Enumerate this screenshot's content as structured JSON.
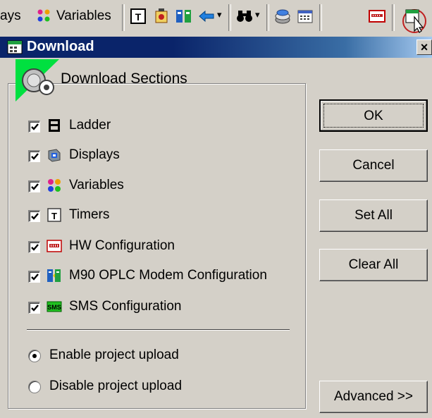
{
  "toolbar": {
    "partial_label": "ays",
    "variables_label": "Variables",
    "items": [
      {
        "icon": "timer-icon"
      },
      {
        "icon": "hw-icon"
      },
      {
        "icon": "modem-icon"
      },
      {
        "icon": "back-arrow-icon"
      },
      {
        "icon": "binoculars-icon"
      },
      {
        "icon": "stack-icon"
      },
      {
        "icon": "calendar-icon"
      },
      {
        "icon": "hw-config-icon"
      },
      {
        "icon": "download-icon"
      }
    ]
  },
  "dialog": {
    "title": "Download",
    "close_glyph": "×",
    "group_title": "Download Sections",
    "sections": [
      {
        "label": "Ladder",
        "checked": true,
        "icon": "ladder-icon"
      },
      {
        "label": "Displays",
        "checked": true,
        "icon": "displays-icon"
      },
      {
        "label": "Variables",
        "checked": true,
        "icon": "variables-icon"
      },
      {
        "label": "Timers",
        "checked": true,
        "icon": "timers-icon"
      },
      {
        "label": "HW Configuration",
        "checked": true,
        "icon": "hw-configuration-icon"
      },
      {
        "label": "M90 OPLC Modem Configuration",
        "checked": true,
        "icon": "modem-configuration-icon"
      },
      {
        "label": "SMS Configuration",
        "checked": true,
        "icon": "sms-configuration-icon"
      }
    ],
    "upload_options": [
      {
        "label": "Enable project upload",
        "selected": true
      },
      {
        "label": "Disable project upload",
        "selected": false
      }
    ],
    "buttons": {
      "ok": "OK",
      "cancel": "Cancel",
      "set_all": "Set All",
      "clear_all": "Clear All",
      "advanced": "Advanced >>"
    }
  }
}
